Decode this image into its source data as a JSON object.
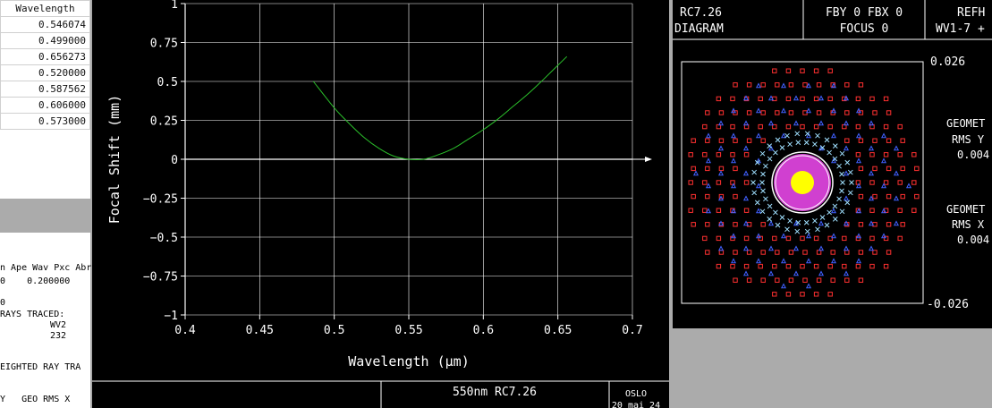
{
  "wavelength_table": {
    "header": "Wavelength",
    "rows": [
      "0.546074",
      "0.499000",
      "0.656273",
      "0.520000",
      "0.587562",
      "0.606000",
      "0.573000"
    ]
  },
  "lower_text": {
    "header": "n Ape Wav Pxc Abr",
    "value_row": "0    0.200000",
    "line0": "0",
    "rays_traced": "RAYS TRACED:",
    "wv2": "WV2",
    "count": "232",
    "weighted": "EIGHTED RAY TRA",
    "geo_rms": "Y   GEO RMS X"
  },
  "plot_footer": {
    "title": "550nm RC7.26",
    "program": "OSLO",
    "date": "20 mai 24"
  },
  "spot_header": {
    "name": "RC7.26",
    "diagram": "DIAGRAM",
    "field": "FBY 0 FBX 0",
    "focus": "FOCUS 0",
    "ref": "REFH",
    "wv": "WV1-7 +",
    "scale_top": "0.026",
    "scale_bottom": "-0.026",
    "geo_y_title": "GEOMET",
    "rms_y_label": "RMS Y",
    "rms_y_value": "0.004",
    "geo_x_title": "GEOMET",
    "rms_x_label": "RMS X",
    "rms_x_value": "0.004"
  },
  "colors": {
    "curve": "#2bbf2b",
    "grid": "#ffffff",
    "spot_red": "#ff3030",
    "spot_blue": "#4060ff",
    "spot_cyan": "#a0e0ff",
    "spot_magenta": "#d040d0",
    "spot_yellow": "#ffff00"
  },
  "chart_data": {
    "type": "line",
    "xlabel": "Wavelength (μm)",
    "ylabel": "Focal Shift (mm)",
    "xlim": [
      0.4,
      0.7
    ],
    "ylim": [
      -1,
      1
    ],
    "x_ticks": [
      "0.4",
      "0.45",
      "0.5",
      "0.55",
      "0.6",
      "0.65",
      "0.7"
    ],
    "y_ticks": [
      "1",
      "0.75",
      "0.5",
      "0.25",
      "0",
      "−0.25",
      "−0.5",
      "−0.75",
      "−1"
    ],
    "grid": true,
    "series": [
      {
        "x": [
          0.486,
          0.5,
          0.51,
          0.52,
          0.53,
          0.54,
          0.55,
          0.56,
          0.57,
          0.58,
          0.59,
          0.6,
          0.61,
          0.62,
          0.63,
          0.64,
          0.656
        ],
        "values": [
          0.5,
          0.33,
          0.23,
          0.14,
          0.07,
          0.02,
          0.0,
          0.0,
          0.03,
          0.07,
          0.13,
          0.19,
          0.26,
          0.34,
          0.42,
          0.51,
          0.66
        ]
      }
    ]
  }
}
